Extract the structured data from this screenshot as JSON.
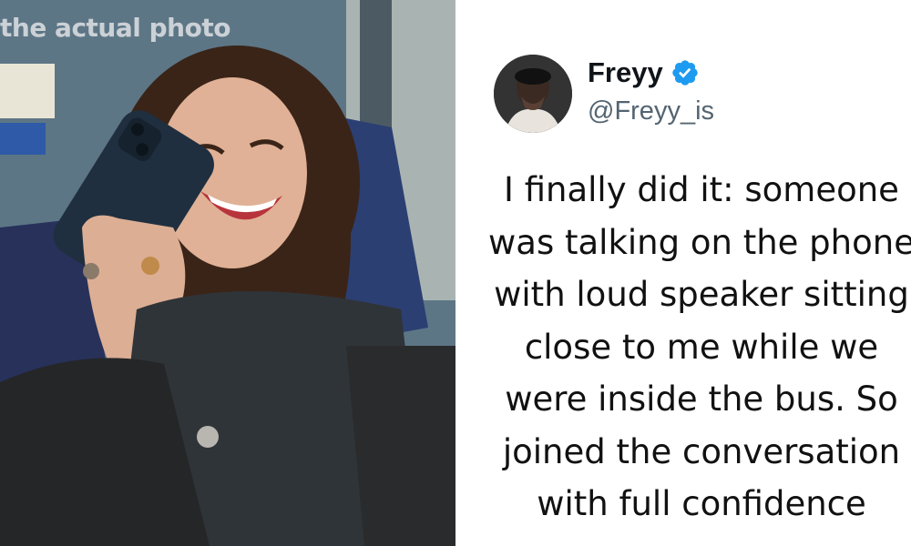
{
  "photo": {
    "caption": "the actual photo"
  },
  "tweet": {
    "display_name": "Freyy",
    "handle": "@Freyy_is",
    "verified": true,
    "accent_color": "#1d9bf0",
    "lines": [
      "I finally did it: someone",
      "was talking on the phone",
      "with loud speaker sitting",
      "close to me while we",
      "were inside the bus. So",
      "joined the conversation",
      "with full confidence"
    ]
  }
}
